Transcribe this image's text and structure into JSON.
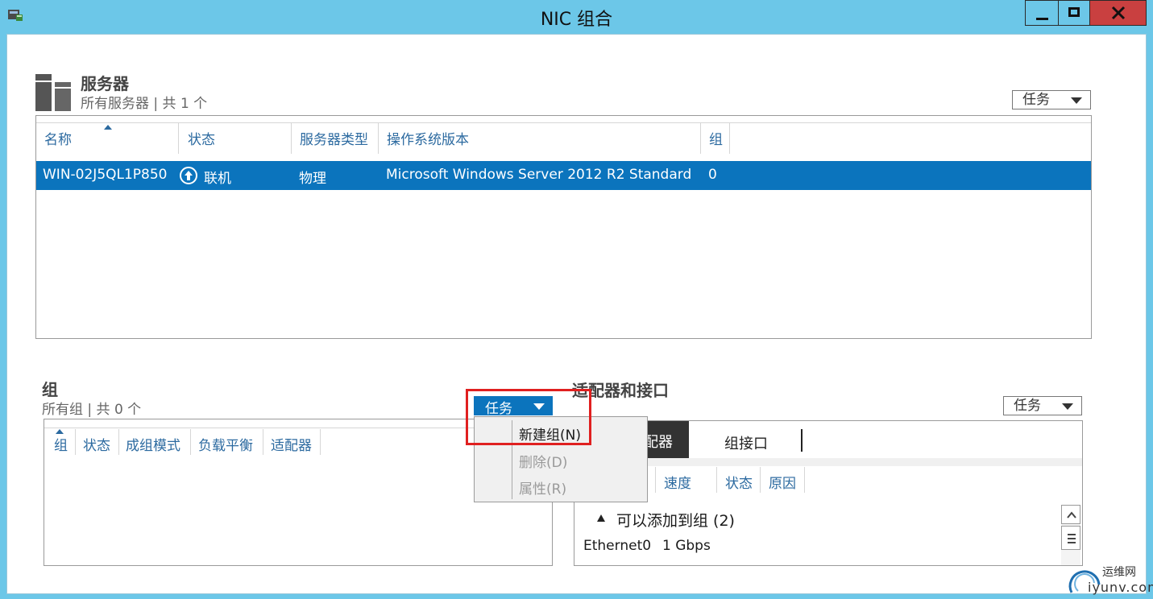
{
  "window": {
    "title": "NIC 组合"
  },
  "servers": {
    "title": "服务器",
    "subtitle": "所有服务器 | 共 1 个",
    "tasks_label": "任务",
    "columns": [
      "名称",
      "状态",
      "服务器类型",
      "操作系统版本",
      "组"
    ],
    "rows": [
      {
        "name": "WIN-02J5QL1P850",
        "status": "联机",
        "type": "物理",
        "os": "Microsoft Windows Server 2012 R2 Standard",
        "groups": "0"
      }
    ]
  },
  "groups": {
    "title": "组",
    "subtitle": "所有组 | 共 0 个",
    "tasks_label": "任务",
    "columns": [
      "组",
      "状态",
      "成组模式",
      "负载平衡",
      "适配器"
    ]
  },
  "tasks_menu": {
    "items": [
      {
        "label": "新建组(N)",
        "enabled": true
      },
      {
        "label": "删除(D)",
        "enabled": false
      },
      {
        "label": "属性(R)",
        "enabled": false
      }
    ]
  },
  "adapters": {
    "title": "适配器和接口",
    "tasks_label": "任务",
    "tabs": [
      "网络适配器",
      "组接口"
    ],
    "tab_active_visible": "配器",
    "columns": [
      "速度",
      "状态",
      "原因"
    ],
    "group_header": "可以添加到组 (2)",
    "rows": [
      {
        "name": "Ethernet0",
        "speed": "1 Gbps"
      }
    ]
  },
  "watermark": {
    "text": "运维网",
    "url_text": "iyunv.com"
  },
  "colors": {
    "selection": "#0b74bd",
    "titlebar": "#6cc7e8",
    "close": "#c94040",
    "highlight": "#e02020"
  }
}
